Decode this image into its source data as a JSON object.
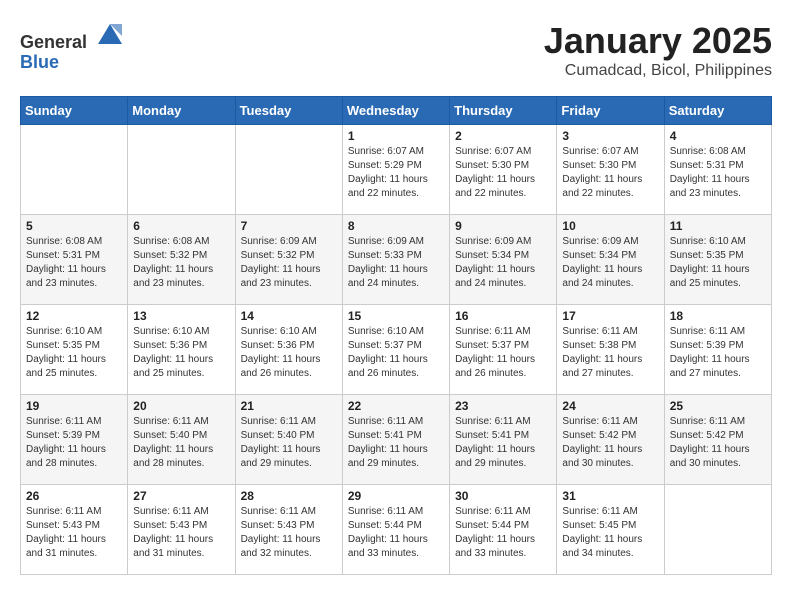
{
  "header": {
    "logo_general": "General",
    "logo_blue": "Blue",
    "title": "January 2025",
    "subtitle": "Cumadcad, Bicol, Philippines"
  },
  "days_of_week": [
    "Sunday",
    "Monday",
    "Tuesday",
    "Wednesday",
    "Thursday",
    "Friday",
    "Saturday"
  ],
  "weeks": [
    [
      {
        "day": "",
        "sunrise": "",
        "sunset": "",
        "daylight": ""
      },
      {
        "day": "",
        "sunrise": "",
        "sunset": "",
        "daylight": ""
      },
      {
        "day": "",
        "sunrise": "",
        "sunset": "",
        "daylight": ""
      },
      {
        "day": "1",
        "sunrise": "Sunrise: 6:07 AM",
        "sunset": "Sunset: 5:29 PM",
        "daylight": "Daylight: 11 hours and 22 minutes."
      },
      {
        "day": "2",
        "sunrise": "Sunrise: 6:07 AM",
        "sunset": "Sunset: 5:30 PM",
        "daylight": "Daylight: 11 hours and 22 minutes."
      },
      {
        "day": "3",
        "sunrise": "Sunrise: 6:07 AM",
        "sunset": "Sunset: 5:30 PM",
        "daylight": "Daylight: 11 hours and 22 minutes."
      },
      {
        "day": "4",
        "sunrise": "Sunrise: 6:08 AM",
        "sunset": "Sunset: 5:31 PM",
        "daylight": "Daylight: 11 hours and 23 minutes."
      }
    ],
    [
      {
        "day": "5",
        "sunrise": "Sunrise: 6:08 AM",
        "sunset": "Sunset: 5:31 PM",
        "daylight": "Daylight: 11 hours and 23 minutes."
      },
      {
        "day": "6",
        "sunrise": "Sunrise: 6:08 AM",
        "sunset": "Sunset: 5:32 PM",
        "daylight": "Daylight: 11 hours and 23 minutes."
      },
      {
        "day": "7",
        "sunrise": "Sunrise: 6:09 AM",
        "sunset": "Sunset: 5:32 PM",
        "daylight": "Daylight: 11 hours and 23 minutes."
      },
      {
        "day": "8",
        "sunrise": "Sunrise: 6:09 AM",
        "sunset": "Sunset: 5:33 PM",
        "daylight": "Daylight: 11 hours and 24 minutes."
      },
      {
        "day": "9",
        "sunrise": "Sunrise: 6:09 AM",
        "sunset": "Sunset: 5:34 PM",
        "daylight": "Daylight: 11 hours and 24 minutes."
      },
      {
        "day": "10",
        "sunrise": "Sunrise: 6:09 AM",
        "sunset": "Sunset: 5:34 PM",
        "daylight": "Daylight: 11 hours and 24 minutes."
      },
      {
        "day": "11",
        "sunrise": "Sunrise: 6:10 AM",
        "sunset": "Sunset: 5:35 PM",
        "daylight": "Daylight: 11 hours and 25 minutes."
      }
    ],
    [
      {
        "day": "12",
        "sunrise": "Sunrise: 6:10 AM",
        "sunset": "Sunset: 5:35 PM",
        "daylight": "Daylight: 11 hours and 25 minutes."
      },
      {
        "day": "13",
        "sunrise": "Sunrise: 6:10 AM",
        "sunset": "Sunset: 5:36 PM",
        "daylight": "Daylight: 11 hours and 25 minutes."
      },
      {
        "day": "14",
        "sunrise": "Sunrise: 6:10 AM",
        "sunset": "Sunset: 5:36 PM",
        "daylight": "Daylight: 11 hours and 26 minutes."
      },
      {
        "day": "15",
        "sunrise": "Sunrise: 6:10 AM",
        "sunset": "Sunset: 5:37 PM",
        "daylight": "Daylight: 11 hours and 26 minutes."
      },
      {
        "day": "16",
        "sunrise": "Sunrise: 6:11 AM",
        "sunset": "Sunset: 5:37 PM",
        "daylight": "Daylight: 11 hours and 26 minutes."
      },
      {
        "day": "17",
        "sunrise": "Sunrise: 6:11 AM",
        "sunset": "Sunset: 5:38 PM",
        "daylight": "Daylight: 11 hours and 27 minutes."
      },
      {
        "day": "18",
        "sunrise": "Sunrise: 6:11 AM",
        "sunset": "Sunset: 5:39 PM",
        "daylight": "Daylight: 11 hours and 27 minutes."
      }
    ],
    [
      {
        "day": "19",
        "sunrise": "Sunrise: 6:11 AM",
        "sunset": "Sunset: 5:39 PM",
        "daylight": "Daylight: 11 hours and 28 minutes."
      },
      {
        "day": "20",
        "sunrise": "Sunrise: 6:11 AM",
        "sunset": "Sunset: 5:40 PM",
        "daylight": "Daylight: 11 hours and 28 minutes."
      },
      {
        "day": "21",
        "sunrise": "Sunrise: 6:11 AM",
        "sunset": "Sunset: 5:40 PM",
        "daylight": "Daylight: 11 hours and 29 minutes."
      },
      {
        "day": "22",
        "sunrise": "Sunrise: 6:11 AM",
        "sunset": "Sunset: 5:41 PM",
        "daylight": "Daylight: 11 hours and 29 minutes."
      },
      {
        "day": "23",
        "sunrise": "Sunrise: 6:11 AM",
        "sunset": "Sunset: 5:41 PM",
        "daylight": "Daylight: 11 hours and 29 minutes."
      },
      {
        "day": "24",
        "sunrise": "Sunrise: 6:11 AM",
        "sunset": "Sunset: 5:42 PM",
        "daylight": "Daylight: 11 hours and 30 minutes."
      },
      {
        "day": "25",
        "sunrise": "Sunrise: 6:11 AM",
        "sunset": "Sunset: 5:42 PM",
        "daylight": "Daylight: 11 hours and 30 minutes."
      }
    ],
    [
      {
        "day": "26",
        "sunrise": "Sunrise: 6:11 AM",
        "sunset": "Sunset: 5:43 PM",
        "daylight": "Daylight: 11 hours and 31 minutes."
      },
      {
        "day": "27",
        "sunrise": "Sunrise: 6:11 AM",
        "sunset": "Sunset: 5:43 PM",
        "daylight": "Daylight: 11 hours and 31 minutes."
      },
      {
        "day": "28",
        "sunrise": "Sunrise: 6:11 AM",
        "sunset": "Sunset: 5:43 PM",
        "daylight": "Daylight: 11 hours and 32 minutes."
      },
      {
        "day": "29",
        "sunrise": "Sunrise: 6:11 AM",
        "sunset": "Sunset: 5:44 PM",
        "daylight": "Daylight: 11 hours and 33 minutes."
      },
      {
        "day": "30",
        "sunrise": "Sunrise: 6:11 AM",
        "sunset": "Sunset: 5:44 PM",
        "daylight": "Daylight: 11 hours and 33 minutes."
      },
      {
        "day": "31",
        "sunrise": "Sunrise: 6:11 AM",
        "sunset": "Sunset: 5:45 PM",
        "daylight": "Daylight: 11 hours and 34 minutes."
      },
      {
        "day": "",
        "sunrise": "",
        "sunset": "",
        "daylight": ""
      }
    ]
  ]
}
